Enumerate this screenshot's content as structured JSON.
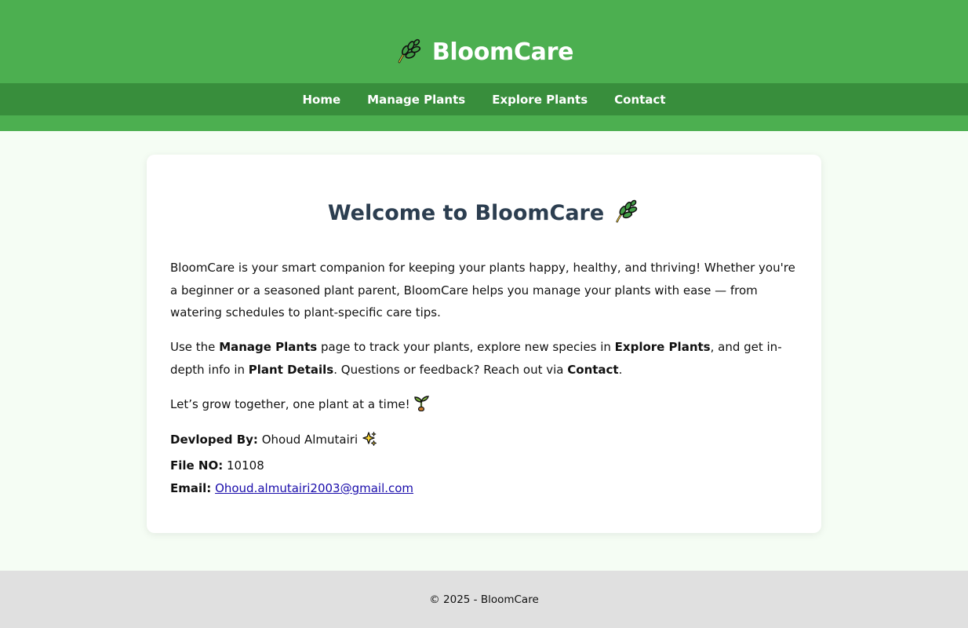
{
  "header": {
    "brand": "BloomCare",
    "brand_icon": "leaf-icon"
  },
  "nav": {
    "items": [
      {
        "label": "Home"
      },
      {
        "label": "Manage Plants"
      },
      {
        "label": "Explore Plants"
      },
      {
        "label": "Contact"
      }
    ]
  },
  "main": {
    "title": "Welcome to BloomCare",
    "title_icon": "leaf-icon",
    "intro": "BloomCare is your smart companion for keeping your plants happy, healthy, and thriving! Whether you're a beginner or a seasoned plant parent, BloomCare helps you manage your plants with ease — from watering schedules to plant-specific care tips.",
    "usage": {
      "part1": "Use the ",
      "manage": "Manage Plants",
      "part2": " page to track your plants, explore new species in ",
      "explore": "Explore Plants",
      "part3": ", and get in-depth info in ",
      "details": "Plant Details",
      "part4": ". Questions or feedback? Reach out via ",
      "contact": "Contact",
      "part5": "."
    },
    "closing": "Let’s grow together, one plant at a time!",
    "closing_icon": "seedling-icon",
    "developer_label": "Devloped By:",
    "developer_name": "Ohoud Almutairi",
    "developer_icon": "sparkles-icon",
    "file_label": "File NO:",
    "file_no": "10108",
    "email_label": "Email:",
    "email": "Ohoud.almutairi2003@gmail.com"
  },
  "footer": {
    "text": "© 2025 - BloomCare"
  },
  "colors": {
    "header_bg": "#4caf50",
    "nav_bg": "#388e3c",
    "page_bg": "#f5fdf4",
    "title_color": "#2c3e50",
    "footer_bg": "#e0e0e0"
  }
}
